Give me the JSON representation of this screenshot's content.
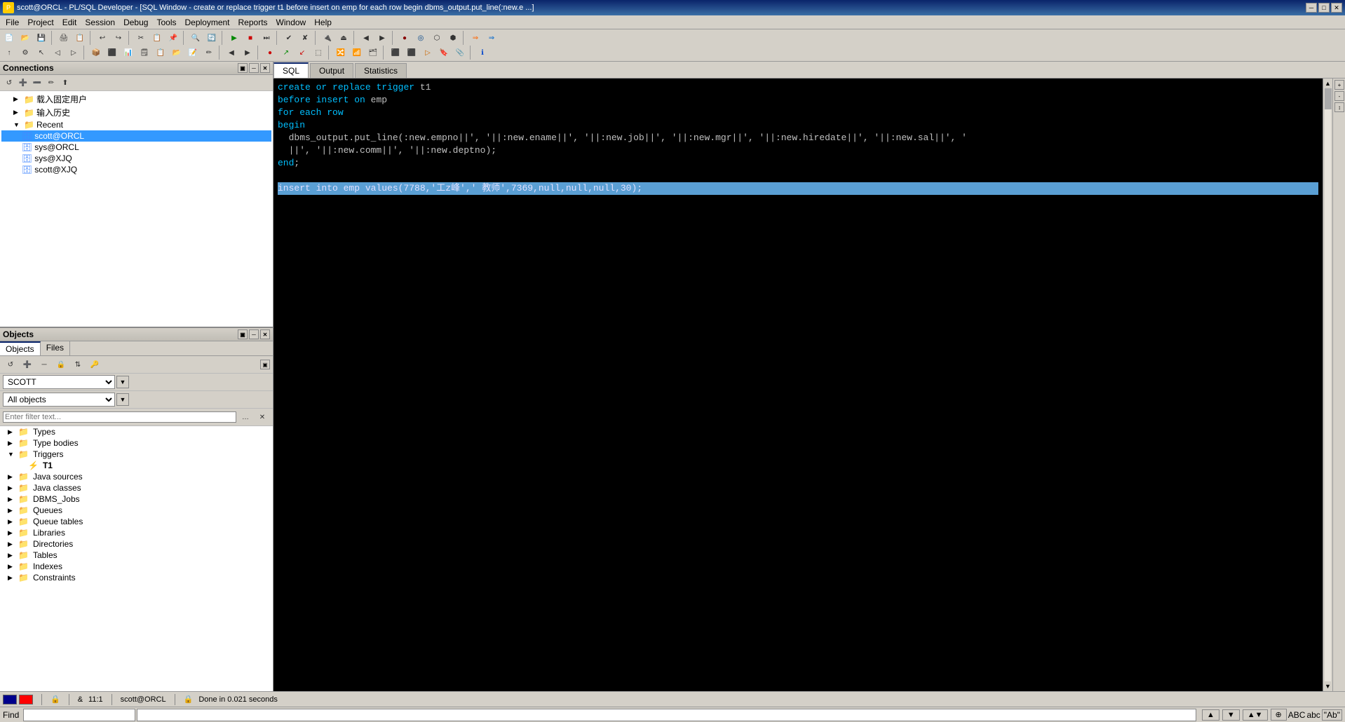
{
  "titleBar": {
    "title": "scott@ORCL - PL/SQL Developer - [SQL Window - create or replace trigger t1 before insert on emp for each row begin dbms_output.put_line(:new.e ...]",
    "minBtn": "─",
    "maxBtn": "□",
    "closeBtn": "✕"
  },
  "menuBar": {
    "items": [
      "File",
      "Project",
      "Edit",
      "Session",
      "Debug",
      "Tools",
      "Deployment",
      "Reports",
      "Window",
      "Help"
    ]
  },
  "connectionsPanel": {
    "title": "Connections",
    "items": [
      {
        "label": "载入固定用户",
        "indent": 1,
        "type": "folder",
        "expanded": false
      },
      {
        "label": "输入历史",
        "indent": 1,
        "type": "folder",
        "expanded": false
      },
      {
        "label": "Recent",
        "indent": 1,
        "type": "folder",
        "expanded": true
      },
      {
        "label": "scott@ORCL",
        "indent": 2,
        "type": "conn",
        "selected": true
      },
      {
        "label": "sys@ORCL",
        "indent": 2,
        "type": "conn"
      },
      {
        "label": "sys@XJQ",
        "indent": 2,
        "type": "conn"
      },
      {
        "label": "scott@XJQ",
        "indent": 2,
        "type": "conn"
      }
    ]
  },
  "objectsPanel": {
    "tabs": [
      "Objects",
      "Files"
    ],
    "activeTab": "Objects",
    "schema": "SCOTT",
    "filter": "Enter filter text...",
    "allObjects": "All objects",
    "items": [
      {
        "label": "Types",
        "indent": 0,
        "type": "folder",
        "expanded": false
      },
      {
        "label": "Type bodies",
        "indent": 0,
        "type": "folder",
        "expanded": false
      },
      {
        "label": "Triggers",
        "indent": 0,
        "type": "folder",
        "expanded": true
      },
      {
        "label": "T1",
        "indent": 1,
        "type": "trigger"
      },
      {
        "label": "Java sources",
        "indent": 0,
        "type": "folder",
        "expanded": false
      },
      {
        "label": "Java classes",
        "indent": 0,
        "type": "folder",
        "expanded": false
      },
      {
        "label": "DBMS_Jobs",
        "indent": 0,
        "type": "folder",
        "expanded": false
      },
      {
        "label": "Queues",
        "indent": 0,
        "type": "folder",
        "expanded": false
      },
      {
        "label": "Queue tables",
        "indent": 0,
        "type": "folder",
        "expanded": false
      },
      {
        "label": "Libraries",
        "indent": 0,
        "type": "folder",
        "expanded": false
      },
      {
        "label": "Directories",
        "indent": 0,
        "type": "folder",
        "expanded": false
      },
      {
        "label": "Tables",
        "indent": 0,
        "type": "folder",
        "expanded": false
      },
      {
        "label": "Indexes",
        "indent": 0,
        "type": "folder",
        "expanded": false
      },
      {
        "label": "Constraints",
        "indent": 0,
        "type": "folder",
        "expanded": false
      }
    ]
  },
  "sqlEditor": {
    "tabs": [
      "SQL",
      "Output",
      "Statistics"
    ],
    "activeTab": "SQL",
    "codeLines": [
      {
        "text": "create or replace trigger t1",
        "highlighted": false
      },
      {
        "text": "before insert on emp",
        "highlighted": false
      },
      {
        "text": "for each row",
        "highlighted": false
      },
      {
        "text": "begin",
        "highlighted": false
      },
      {
        "text": "  dbms_output.put_line(:new.empno||', '||:new.ename||', '||:new.job||', '||:new.mgr||', '||:new.hiredate||', '||:new.sal||', '",
        "highlighted": false
      },
      {
        "text": "  ||', '||:new.comm||', '||:new.deptno);",
        "highlighted": false
      },
      {
        "text": "end;",
        "highlighted": false
      },
      {
        "text": "",
        "highlighted": false
      },
      {
        "text": "insert into emp values(7788,'工z峰',' 教师',7369,null,null,null,30);",
        "highlighted": true
      }
    ]
  },
  "statusBar": {
    "position": "11:1",
    "schema": "scott@ORCL",
    "status": "Done in 0.021 seconds"
  },
  "findBar": {
    "label": "Find",
    "placeholder": ""
  }
}
